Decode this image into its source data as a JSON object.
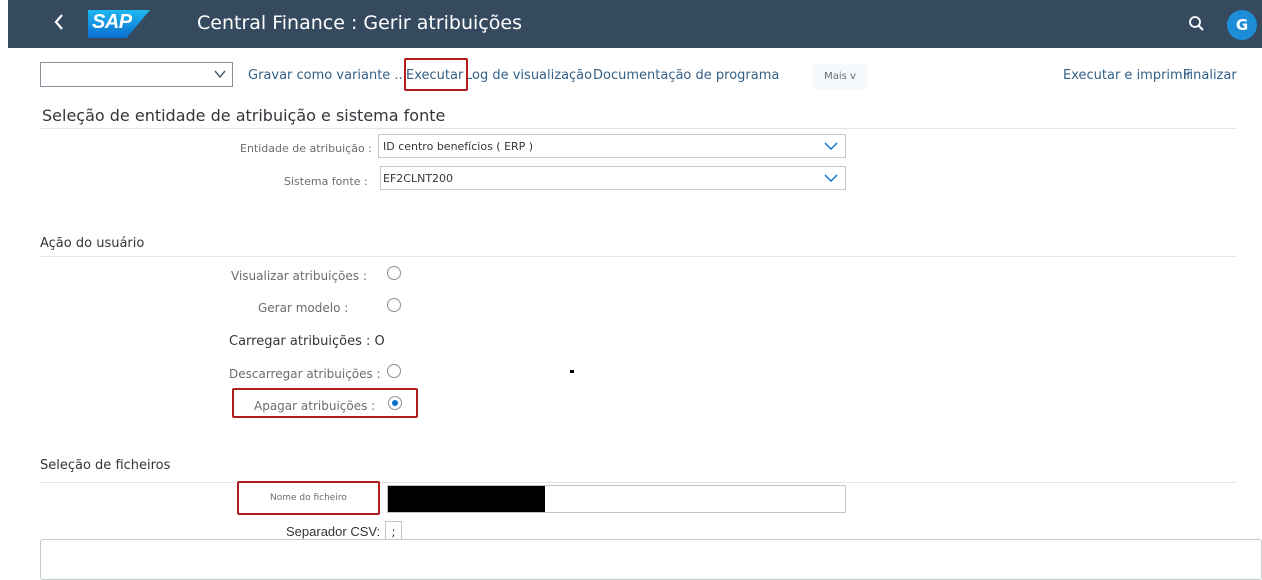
{
  "shell": {
    "back_icon": "chevron-left-icon",
    "logo_text": "SAP",
    "title": "Central Finance : Gerir atribuições",
    "avatar_letter": "G"
  },
  "toolbar": {
    "variant_value": "",
    "save_variant": "Gravar como variante ...",
    "execute": "Executar",
    "view_log": "Log de visualização",
    "program_docs": "Documentação de programa",
    "more": "Mais",
    "more_arrow": "v",
    "execute_print": "Executar e imprimir",
    "finish": "Finalizar"
  },
  "section1": {
    "title": "Seleção de entidade de atribuição e sistema fonte",
    "entity_label": "Entidade de atribuição :",
    "entity_value": "ID centro benefícios ( ERP )",
    "source_label": "Sistema fonte :",
    "source_value": "EF2CLNT200"
  },
  "section2": {
    "title": "Ação do usuário",
    "options": [
      {
        "label": "Visualizar atribuições :",
        "selected": false
      },
      {
        "label": "Gerar modelo :",
        "selected": false
      },
      {
        "label": "Carregar atribuições : O",
        "selected": false
      },
      {
        "label": "Descarregar atribuições :",
        "selected": false
      },
      {
        "label": "Apagar atribuições :",
        "selected": true
      }
    ]
  },
  "section3": {
    "title": "Seleção de ficheiros",
    "file_label": "Nome do ficheiro",
    "file_value": "",
    "csv_label": "Separador CSV:",
    "csv_value": ";"
  },
  "colors": {
    "shell": "#354a5f",
    "link": "#346187",
    "highlight": "#b01b1b",
    "radio_selected": "#0a6ed1"
  }
}
